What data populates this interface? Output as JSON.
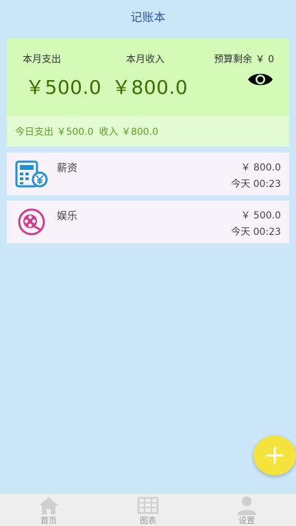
{
  "header": {
    "title": "记账本"
  },
  "summary": {
    "month_expense_label": "本月支出",
    "month_income_label": "本月收入",
    "budget_label": "预算剩余 ￥ 0",
    "month_expense_value": "￥500.0",
    "month_income_value": "￥800.0",
    "today_expense": "今日支出 ￥500.0",
    "today_income": "收入 ￥800.0"
  },
  "records": [
    {
      "name": "薪资",
      "amount": "￥ 800.0",
      "time": "今天 00:23",
      "icon": "calculator-icon"
    },
    {
      "name": "娱乐",
      "amount": "￥ 500.0",
      "time": "今天 00:23",
      "icon": "film-reel-icon"
    }
  ],
  "tabs": [
    {
      "label": "首页",
      "icon": "home-icon"
    },
    {
      "label": "图表",
      "icon": "chart-grid-icon"
    },
    {
      "label": "设置",
      "icon": "person-icon"
    }
  ],
  "colors": {
    "background": "#cbe7f8",
    "summary_bg": "#d4fab8",
    "amount_green": "#3c6e00",
    "title_blue": "#2d57a8",
    "fab_yellow": "#f5e43c"
  }
}
